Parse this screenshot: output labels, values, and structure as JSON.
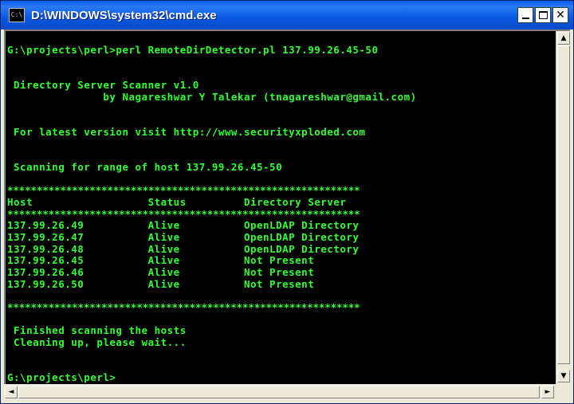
{
  "window": {
    "title": "D:\\WINDOWS\\system32\\cmd.exe",
    "icon_label": "C:\\",
    "minimize_icon": "minimize-icon",
    "maximize_icon": "maximize-icon",
    "close_icon": "close-icon",
    "close_glyph": "✕"
  },
  "console": {
    "lines": [
      "G:\\projects\\perl>perl RemoteDirDetector.pl 137.99.26.45-50",
      " Directory Server Scanner v1.0",
      "               by Nagareshwar Y Talekar (tnagareshwar@gmail.com)",
      " For latest version visit http://www.securityxploded.com",
      " Scanning for range of host 137.99.26.45-50",
      "************************************************************",
      "Host                  Status         Directory Server",
      "************************************************************",
      "137.99.26.49          Alive          OpenLDAP Directory",
      "137.99.26.47          Alive          OpenLDAP Directory",
      "137.99.26.48          Alive          OpenLDAP Directory",
      "137.99.26.45          Alive          Not Present",
      "137.99.26.46          Alive          Not Present",
      "137.99.26.50          Alive          Not Present",
      "************************************************************",
      " Finished scanning the hosts",
      " Cleaning up, please wait...",
      "G:\\projects\\perl>"
    ]
  },
  "scrollbars": {
    "up_arrow": "▲",
    "down_arrow": "▼",
    "left_arrow": "◄",
    "right_arrow": "►"
  }
}
